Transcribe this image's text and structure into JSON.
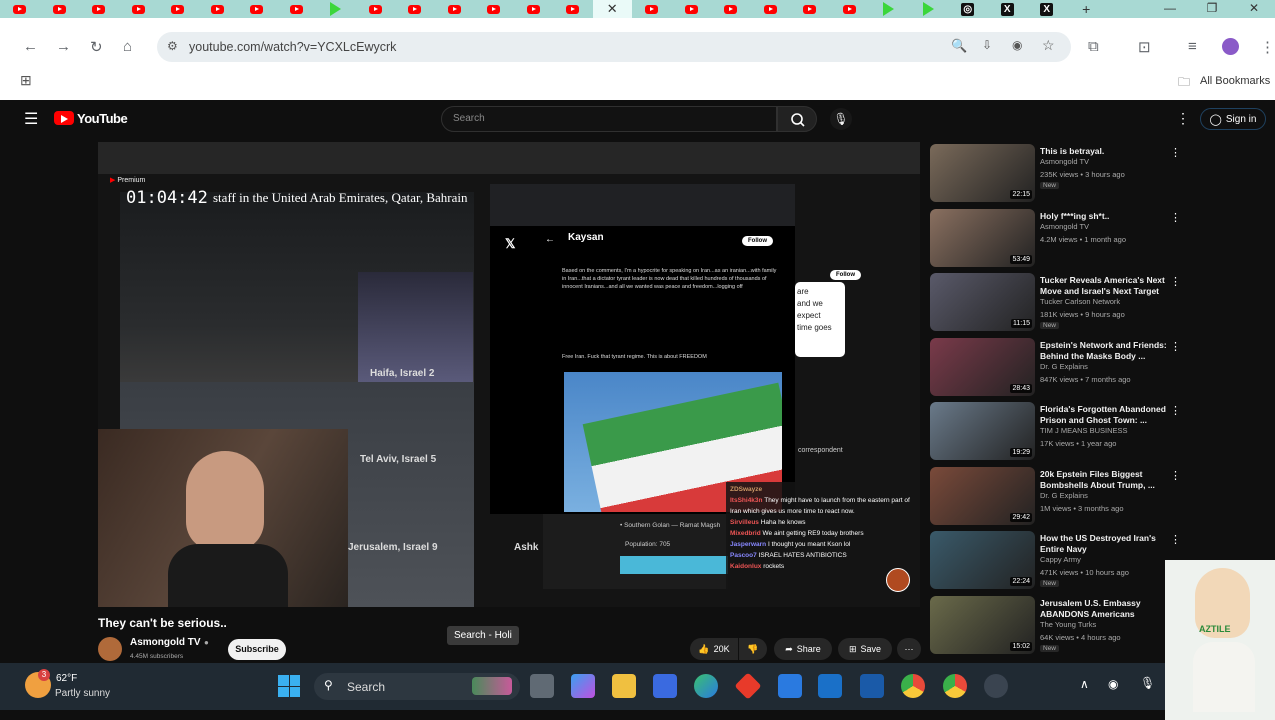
{
  "browser": {
    "tabs": [
      "yt",
      "yt",
      "yt",
      "yt",
      "yt",
      "yt",
      "yt",
      "yt",
      "play",
      "yt",
      "yt",
      "yt",
      "yt",
      "yt",
      "yt",
      "active",
      "yt",
      "yt",
      "yt",
      "yt",
      "yt",
      "yt",
      "play",
      "play",
      "ig",
      "x",
      "x"
    ],
    "url": "youtube.com/watch?v=YCXLcEwycrk",
    "all_bookmarks": "All Bookmarks"
  },
  "youtube": {
    "search_placeholder": "Search",
    "signin": "Sign in",
    "logo": "YouTube"
  },
  "video": {
    "timestamp": "01:04:42",
    "ticker": "staff in the United Arab Emirates, Qatar, Bahrain",
    "cam_labels": {
      "haifa": "Haifa, Israel  2",
      "telaviv": "Tel Aviv, Israel  5",
      "jerusalem": "Jerusalem, Israel  9",
      "ashk": "Ashk"
    },
    "premium": "Premium",
    "tweet_profile": "Kaysan",
    "follow": "Follow",
    "tweet1_text": "Based on the comments, I'm a hypocrite for speaking on Iran...as an iranian...with family in Iran...that a dictator tyrant leader is now dead that killed hundreds of thousands of innocent Iranians...and all we wanted was peace and freedom...logging off",
    "tweet2_text": "Free Iran. Fuck that tyrant regime. This is about FREEDOM",
    "popup_text": [
      "are",
      "and we",
      "expect",
      "time goes"
    ],
    "location": "• Southern Golan — Ramat Magsh",
    "population": "Population: 705",
    "correspondent": "correspondent",
    "chat": [
      {
        "user": "ZDSwayze",
        "msg": ""
      },
      {
        "user": "ItsShi4k3n",
        "msg": "They might have to launch from the eastern part of Iran which gives us more time to react now."
      },
      {
        "user": "Sirvilleus",
        "msg": "Haha he knows"
      },
      {
        "user": "Mixedbrid",
        "msg": "We aint getting RE9 today brothers"
      },
      {
        "user": "Jasperwarn",
        "msg": "I thought you meant Kson lol"
      },
      {
        "user": "Pascoo7",
        "msg": "ISRAEL HATES ANTIBIOTICS"
      },
      {
        "user": "Kaidonlux",
        "msg": "rockets"
      }
    ],
    "tooltip": "Search - Holi"
  },
  "meta": {
    "title": "They can't be serious..",
    "channel": "Asmongold TV",
    "subscribers": "4.45M subscribers",
    "subscribe": "Subscribe",
    "likes": "20K",
    "share": "Share",
    "save": "Save"
  },
  "recommendations": [
    {
      "title": "This is betrayal.",
      "channel": "Asmongold TV",
      "meta": "235K views • 3 hours ago",
      "badge": "New",
      "duration": "22:15",
      "color": "#7a6a5a"
    },
    {
      "title": "Holy f***ing sh*t..",
      "channel": "Asmongold TV",
      "meta": "4.2M views • 1 month ago",
      "badge": "",
      "duration": "53:49",
      "color": "#8a7060"
    },
    {
      "title": "Tucker Reveals America's Next Move and Israel's Next Target",
      "channel": "Tucker Carlson Network",
      "meta": "181K views • 9 hours ago",
      "badge": "New",
      "duration": "11:15",
      "color": "#5a5a6a"
    },
    {
      "title": "Epstein's Network and Friends: Behind the Masks Body ...",
      "channel": "Dr. G Explains",
      "meta": "847K views • 7 months ago",
      "badge": "",
      "duration": "28:43",
      "color": "#7a3a4a"
    },
    {
      "title": "Florida's Forgotten Abandoned Prison and Ghost Town: ...",
      "channel": "TIM J MEANS BUSINESS",
      "meta": "17K views • 1 year ago",
      "badge": "",
      "duration": "19:29",
      "color": "#6a7a8a"
    },
    {
      "title": "20k Epstein Files Biggest Bombshells About Trump, ...",
      "channel": "Dr. G Explains",
      "meta": "1M views • 3 months ago",
      "badge": "",
      "duration": "29:42",
      "color": "#7a4a3a"
    },
    {
      "title": "How the US Destroyed Iran's Entire Navy",
      "channel": "Cappy Army",
      "meta": "471K views • 10 hours ago",
      "badge": "New",
      "duration": "22:24",
      "color": "#3a5a6a"
    },
    {
      "title": "Jerusalem U.S. Embassy ABANDONS Americans",
      "channel": "The Young Turks",
      "meta": "64K views • 4 hours ago",
      "badge": "New",
      "duration": "15:02",
      "color": "#6a6a4a"
    }
  ],
  "taskbar": {
    "temp": "62°F",
    "weather": "Partly sunny",
    "search": "Search",
    "notif": "3"
  },
  "sticker_text": "AZTILE"
}
